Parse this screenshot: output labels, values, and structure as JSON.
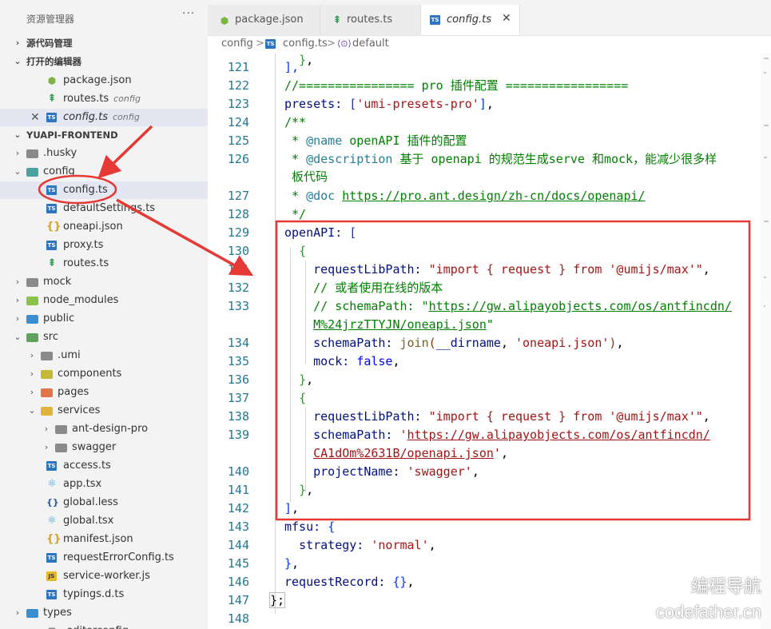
{
  "explorer": {
    "title": "资源管理器",
    "more": "···",
    "sections": {
      "source_control": "源代码管理",
      "open_editors": "打开的编辑器",
      "project": "YUAPI-FRONTEND"
    },
    "open_editors": [
      {
        "name": "package.json",
        "desc": ""
      },
      {
        "name": "routes.ts",
        "desc": "config"
      },
      {
        "name": "config.ts",
        "desc": "config"
      }
    ],
    "close_glyph": "✕",
    "tree": [
      {
        "name": ".husky",
        "icon": "folder"
      },
      {
        "name": "config",
        "icon": "folder-open"
      },
      {
        "name": "config.ts",
        "icon": "ts"
      },
      {
        "name": "defaultSettings.ts",
        "icon": "ts"
      },
      {
        "name": "oneapi.json",
        "icon": "json"
      },
      {
        "name": "proxy.ts",
        "icon": "ts"
      },
      {
        "name": "routes.ts",
        "icon": "route"
      },
      {
        "name": "mock",
        "icon": "folder"
      },
      {
        "name": "node_modules",
        "icon": "folder"
      },
      {
        "name": "public",
        "icon": "folder"
      },
      {
        "name": "src",
        "icon": "folder-open"
      },
      {
        "name": ".umi",
        "icon": "folder"
      },
      {
        "name": "components",
        "icon": "folder"
      },
      {
        "name": "pages",
        "icon": "folder"
      },
      {
        "name": "services",
        "icon": "folder-open"
      },
      {
        "name": "ant-design-pro",
        "icon": "folder"
      },
      {
        "name": "swagger",
        "icon": "folder"
      },
      {
        "name": "access.ts",
        "icon": "ts"
      },
      {
        "name": "app.tsx",
        "icon": "react"
      },
      {
        "name": "global.less",
        "icon": "less"
      },
      {
        "name": "global.tsx",
        "icon": "react"
      },
      {
        "name": "manifest.json",
        "icon": "json"
      },
      {
        "name": "requestErrorConfig.ts",
        "icon": "ts"
      },
      {
        "name": "service-worker.js",
        "icon": "js"
      },
      {
        "name": "typings.d.ts",
        "icon": "ts"
      },
      {
        "name": "types",
        "icon": "folder"
      },
      {
        "name": ".editorconfig",
        "icon": "file"
      }
    ]
  },
  "tabs": [
    {
      "label": "package.json"
    },
    {
      "label": "routes.ts"
    },
    {
      "label": "config.ts"
    }
  ],
  "tab_close": "✕",
  "breadcrumb": {
    "part1": "config",
    "sep": ">",
    "part2": "config.ts",
    "part3": "default"
  },
  "icons": {
    "ts_badge": "TS",
    "js_badge": "JS",
    "json": "{}",
    "route": "⇞",
    "node": "⬢",
    "react": "⚛",
    "less": "{}"
  },
  "code": {
    "line_numbers": [
      "121",
      "122",
      "123",
      "124",
      "125",
      "126",
      "127",
      "128",
      "129",
      "130",
      "131",
      "132",
      "133",
      "134",
      "135",
      "136",
      "137",
      "138",
      "139",
      "140",
      "141",
      "142",
      "143",
      "144",
      "145",
      "146",
      "147",
      "148"
    ],
    "lines": {
      "l121": "],",
      "l122": "//================ pro 插件配置 =================",
      "l123a": "presets: ",
      "l123b": "'umi-presets-pro'",
      "l124": "/**",
      "l125a": " * ",
      "l125b": "@name",
      "l125c": " openAPI 插件的配置",
      "l126a": " * ",
      "l126b": "@description",
      "l126c": " 基于 openapi 的规范生成serve 和mock，能减少很多样",
      "l126d": " 板代码",
      "l127a": " * ",
      "l127b": "@doc",
      "l127c": "https://pro.ant.design/zh-cn/docs/openapi/",
      "l128": " */",
      "l129": "openAPI: ",
      "l131a": "requestLibPath: ",
      "l131b": "\"import { request } from '@umijs/max'\"",
      "l132": "// 或者使用在线的版本",
      "l133a": "// schemaPath: \"",
      "l133b": "https://gw.alipayobjects.com/os/antfincdn/",
      "l133c": "M%24jrzTTYJN/oneapi.json",
      "l133d": "\"",
      "l134a": "schemaPath: ",
      "l134b": "join",
      "l134c": "__dirname",
      "l134d": "'oneapi.json'",
      "l135a": "mock: ",
      "l135b": "false",
      "l138a": "requestLibPath: ",
      "l138b": "\"import { request } from '@umijs/max'\"",
      "l139a": "schemaPath: ",
      "l139b": "https://gw.alipayobjects.com/os/antfincdn/",
      "l139c": "CA1dOm%2631B/openapi.json",
      "l140a": "projectName: ",
      "l140b": "'swagger'",
      "l143": "mfsu: ",
      "l144a": "strategy: ",
      "l144b": "'normal'",
      "l146": "requestRecord: ",
      "l147": "};"
    }
  },
  "watermark": {
    "line1": "编程导航",
    "line2": "codefather.cn"
  },
  "colors": {
    "annotation": "#e53935",
    "ts": "#2f74c0",
    "folder": "#8a8a8a",
    "accent": "#0066b8"
  }
}
